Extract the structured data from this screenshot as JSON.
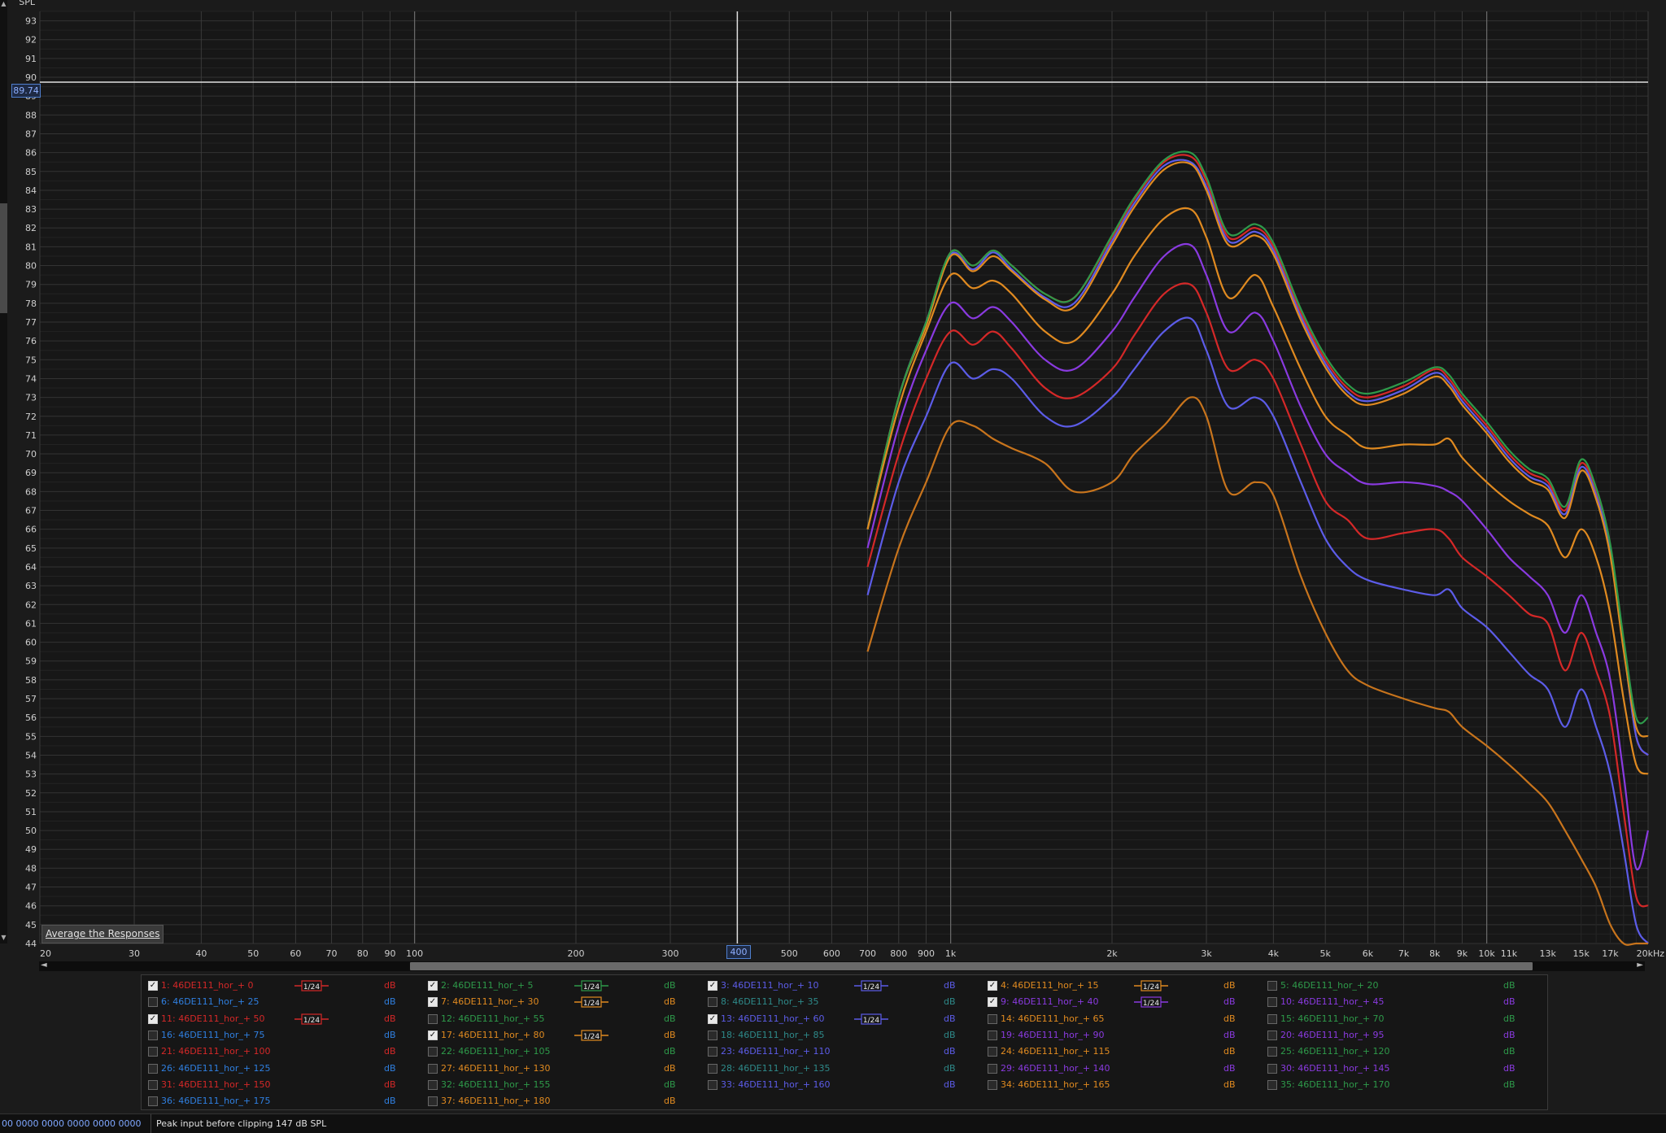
{
  "axis": {
    "y_label": "SPL",
    "x_unit_label": "20kHz"
  },
  "cursor": {
    "level_readout": "89.74",
    "freq_readout": "400",
    "level": 89.74,
    "freq": 400
  },
  "average_button": "Average the Responses",
  "status": {
    "left": "00 0000  0000 0000  0000 0000",
    "message": "Peak input before clipping 147 dB SPL"
  },
  "colors": {
    "background": "#1b1b1b",
    "grid_major": "#3a3a3a",
    "grid_minor": "#262626",
    "cursor": "#e0e0e0",
    "red": "#d42828",
    "blue": "#2f7fe0",
    "green": "#2e9a4a",
    "orange": "#e08a20",
    "purple": "#8a3ae0",
    "indigo": "#5c5ce8"
  },
  "chart_data": {
    "type": "line",
    "xscale": "log",
    "xlim": [
      20,
      20000
    ],
    "ylim": [
      44,
      93.5
    ],
    "ylabel": "SPL",
    "yticks": [
      44,
      45,
      46,
      47,
      48,
      49,
      50,
      51,
      52,
      53,
      54,
      55,
      56,
      57,
      58,
      59,
      60,
      61,
      62,
      63,
      64,
      65,
      66,
      67,
      68,
      69,
      70,
      71,
      72,
      73,
      74,
      75,
      76,
      77,
      78,
      79,
      80,
      81,
      82,
      83,
      84,
      85,
      86,
      87,
      88,
      89,
      90,
      91,
      92,
      93
    ],
    "xticks": [
      {
        "v": 20,
        "label": "20"
      },
      {
        "v": 30,
        "label": "30"
      },
      {
        "v": 40,
        "label": "40"
      },
      {
        "v": 50,
        "label": "50"
      },
      {
        "v": 60,
        "label": "60"
      },
      {
        "v": 70,
        "label": "70"
      },
      {
        "v": 80,
        "label": "80"
      },
      {
        "v": 90,
        "label": "90"
      },
      {
        "v": 100,
        "label": "100"
      },
      {
        "v": 200,
        "label": "200"
      },
      {
        "v": 300,
        "label": "300"
      },
      {
        "v": 400,
        "label": "400"
      },
      {
        "v": 500,
        "label": "500"
      },
      {
        "v": 600,
        "label": "600"
      },
      {
        "v": 700,
        "label": "700"
      },
      {
        "v": 800,
        "label": "800"
      },
      {
        "v": 900,
        "label": "900"
      },
      {
        "v": 1000,
        "label": "1k"
      },
      {
        "v": 2000,
        "label": "2k"
      },
      {
        "v": 3000,
        "label": "3k"
      },
      {
        "v": 4000,
        "label": "4k"
      },
      {
        "v": 5000,
        "label": "5k"
      },
      {
        "v": 6000,
        "label": "6k"
      },
      {
        "v": 7000,
        "label": "7k"
      },
      {
        "v": 8000,
        "label": "8k"
      },
      {
        "v": 9000,
        "label": "9k"
      },
      {
        "v": 10000,
        "label": "10k"
      },
      {
        "v": 11000,
        "label": "11k"
      },
      {
        "v": 13000,
        "label": "13k"
      },
      {
        "v": 15000,
        "label": "15k"
      },
      {
        "v": 17000,
        "label": "17k"
      },
      {
        "v": 20000,
        "label": "20kHz"
      }
    ],
    "x": [
      700,
      800,
      900,
      1000,
      1100,
      1200,
      1300,
      1500,
      1700,
      2000,
      2200,
      2500,
      2800,
      3000,
      3300,
      3700,
      4000,
      4500,
      5000,
      5500,
      6000,
      7000,
      8000,
      8500,
      9000,
      10000,
      11000,
      12000,
      13000,
      14000,
      15000,
      16000,
      17000,
      18000,
      19000,
      20000
    ],
    "series": [
      {
        "name": "1: 46DE111_hor_+ 0",
        "color": "#d42828",
        "values": [
          66,
          73,
          77,
          80.7,
          80,
          80.8,
          80,
          78.5,
          78.3,
          81.5,
          83.5,
          85.5,
          85.8,
          84.5,
          81.5,
          82,
          81,
          77.5,
          75,
          73.5,
          73,
          73.6,
          74.5,
          74,
          73,
          71.5,
          70,
          69,
          68.5,
          67,
          69.5,
          68,
          65,
          60,
          55,
          54
        ]
      },
      {
        "name": "3: 46DE111_hor_+ 10",
        "color": "#5c5ce8",
        "values": [
          66,
          73,
          77,
          80.6,
          79.8,
          80.7,
          79.8,
          78.3,
          78,
          81.3,
          83.3,
          85.3,
          85.5,
          84.2,
          81.3,
          81.8,
          80.8,
          77.3,
          74.8,
          73.3,
          72.8,
          73.4,
          74.3,
          73.8,
          72.8,
          71.3,
          69.8,
          68.8,
          68.3,
          66.8,
          69.3,
          67.8,
          64.8,
          59.8,
          55,
          54
        ]
      },
      {
        "name": "4: 46DE111_hor_+ 15",
        "color": "#e08a20",
        "values": [
          66,
          73,
          76.8,
          80.5,
          79.7,
          80.5,
          79.7,
          78.2,
          77.8,
          81.1,
          83.1,
          85.1,
          85.4,
          84,
          81.1,
          81.6,
          80.6,
          77.1,
          74.6,
          73.1,
          72.6,
          73.2,
          74.1,
          73.6,
          72.6,
          71.1,
          69.6,
          68.6,
          68.1,
          66.6,
          69.1,
          67.6,
          64.6,
          59.6,
          55.5,
          55
        ]
      },
      {
        "name": "2: 46DE111_hor_+ 5",
        "color": "#2e9a4a",
        "values": [
          66,
          73,
          77,
          80.7,
          80,
          80.8,
          80,
          78.5,
          78.3,
          81.6,
          83.6,
          85.6,
          86,
          84.7,
          81.7,
          82.2,
          81.2,
          77.7,
          75.2,
          73.7,
          73.2,
          73.8,
          74.6,
          74.2,
          73.2,
          71.7,
          70.2,
          69.2,
          68.7,
          67.2,
          69.7,
          68.2,
          65.2,
          60.2,
          56,
          56
        ]
      },
      {
        "name": "7: 46DE111_hor_+ 30",
        "color": "#e08a20",
        "values": [
          66,
          72.5,
          76.5,
          79.5,
          78.8,
          79.2,
          78.5,
          76.5,
          76,
          78.5,
          80.5,
          82.5,
          83,
          81.5,
          78.3,
          79.5,
          77.8,
          74.5,
          72,
          71,
          70.3,
          70.5,
          70.5,
          70.8,
          69.8,
          68.5,
          67.5,
          66.8,
          66.2,
          64.5,
          66,
          64.5,
          61.5,
          57,
          53.5,
          53
        ]
      },
      {
        "name": "9: 46DE111_hor_+ 40",
        "color": "#8a3ae0",
        "values": [
          65,
          71.5,
          75.5,
          78,
          77.2,
          77.8,
          77,
          75,
          74.5,
          76.5,
          78.3,
          80.5,
          81.1,
          79.5,
          76.5,
          77.5,
          76,
          72.5,
          70,
          69,
          68.4,
          68.5,
          68.3,
          68,
          67.5,
          66,
          64.5,
          63.5,
          62.5,
          60.5,
          62.5,
          60.5,
          58,
          53,
          48,
          50
        ]
      },
      {
        "name": "11: 46DE111_hor_+ 50",
        "color": "#d42828",
        "values": [
          64,
          70,
          74,
          76.5,
          75.8,
          76.5,
          75.6,
          73.5,
          73,
          74.5,
          76.3,
          78.5,
          79,
          77.5,
          74.5,
          75,
          74,
          70.5,
          67.5,
          66.5,
          65.5,
          65.8,
          66,
          65.5,
          64.5,
          63.5,
          62.5,
          61.5,
          61,
          58.5,
          60.5,
          58.5,
          56,
          51,
          46.5,
          46
        ]
      },
      {
        "name": "13: 46DE111_hor_+ 60",
        "color": "#5c5ce8",
        "values": [
          62.5,
          68.5,
          72,
          74.8,
          74,
          74.5,
          74,
          72,
          71.5,
          73,
          74.5,
          76.5,
          77.2,
          75.5,
          72.5,
          73,
          72,
          68.5,
          65.5,
          64,
          63.3,
          62.8,
          62.5,
          62.8,
          61.8,
          60.8,
          59.5,
          58.3,
          57.5,
          55.5,
          57.5,
          55.5,
          53,
          49,
          45,
          44
        ]
      },
      {
        "name": "17: 46DE111_hor_+ 80",
        "color": "#c8741c",
        "values": [
          59.5,
          65,
          68.5,
          71.5,
          71.5,
          70.8,
          70.3,
          69.5,
          68,
          68.5,
          70,
          71.5,
          73,
          72,
          68,
          68.5,
          67.8,
          63.5,
          60.5,
          58.5,
          57.7,
          57,
          56.5,
          56.3,
          55.5,
          54.5,
          53.5,
          52.5,
          51.5,
          50,
          48.5,
          47,
          45,
          44,
          44,
          44
        ]
      }
    ]
  },
  "legend": {
    "items": [
      {
        "label": "1: 46DE111_hor_+ 0",
        "color": "#d42828",
        "checked": true,
        "smooth": true,
        "db": "dB"
      },
      {
        "label": "2: 46DE111_hor_+ 5",
        "color": "#2e9a4a",
        "checked": true,
        "smooth": true,
        "db": "dB"
      },
      {
        "label": "3: 46DE111_hor_+ 10",
        "color": "#5c5ce8",
        "checked": true,
        "smooth": true,
        "db": "dB"
      },
      {
        "label": "4: 46DE111_hor_+ 15",
        "color": "#e08a20",
        "checked": true,
        "smooth": true,
        "db": "dB"
      },
      {
        "label": "5: 46DE111_hor_+ 20",
        "color": "#2e9a4a",
        "checked": false,
        "smooth": false,
        "db": "dB"
      },
      {
        "label": "6: 46DE111_hor_+ 25",
        "color": "#2f7fe0",
        "checked": false,
        "smooth": false,
        "db": "dB"
      },
      {
        "label": "7: 46DE111_hor_+ 30",
        "color": "#e08a20",
        "checked": true,
        "smooth": true,
        "db": "dB"
      },
      {
        "label": "8: 46DE111_hor_+ 35",
        "color": "#2e8a8a",
        "checked": false,
        "smooth": false,
        "db": "dB"
      },
      {
        "label": "9: 46DE111_hor_+ 40",
        "color": "#8a3ae0",
        "checked": true,
        "smooth": true,
        "db": "dB"
      },
      {
        "label": "10: 46DE111_hor_+ 45",
        "color": "#8a3ae0",
        "checked": false,
        "smooth": false,
        "db": "dB"
      },
      {
        "label": "11: 46DE111_hor_+ 50",
        "color": "#d42828",
        "checked": true,
        "smooth": true,
        "db": "dB"
      },
      {
        "label": "12: 46DE111_hor_+ 55",
        "color": "#2e9a4a",
        "checked": false,
        "smooth": false,
        "db": "dB"
      },
      {
        "label": "13: 46DE111_hor_+ 60",
        "color": "#5c5ce8",
        "checked": true,
        "smooth": true,
        "db": "dB"
      },
      {
        "label": "14: 46DE111_hor_+ 65",
        "color": "#e08a20",
        "checked": false,
        "smooth": false,
        "db": "dB"
      },
      {
        "label": "15: 46DE111_hor_+ 70",
        "color": "#2e9a4a",
        "checked": false,
        "smooth": false,
        "db": "dB"
      },
      {
        "label": "16: 46DE111_hor_+ 75",
        "color": "#2f7fe0",
        "checked": false,
        "smooth": false,
        "db": "dB"
      },
      {
        "label": "17: 46DE111_hor_+ 80",
        "color": "#e08a20",
        "checked": true,
        "smooth": true,
        "db": "dB"
      },
      {
        "label": "18: 46DE111_hor_+ 85",
        "color": "#2e8a8a",
        "checked": false,
        "smooth": false,
        "db": "dB"
      },
      {
        "label": "19: 46DE111_hor_+ 90",
        "color": "#8a3ae0",
        "checked": false,
        "smooth": false,
        "db": "dB"
      },
      {
        "label": "20: 46DE111_hor_+ 95",
        "color": "#8a3ae0",
        "checked": false,
        "smooth": false,
        "db": "dB"
      },
      {
        "label": "21: 46DE111_hor_+ 100",
        "color": "#d42828",
        "checked": false,
        "smooth": false,
        "db": "dB"
      },
      {
        "label": "22: 46DE111_hor_+ 105",
        "color": "#2e9a4a",
        "checked": false,
        "smooth": false,
        "db": "dB"
      },
      {
        "label": "23: 46DE111_hor_+ 110",
        "color": "#5c5ce8",
        "checked": false,
        "smooth": false,
        "db": "dB"
      },
      {
        "label": "24: 46DE111_hor_+ 115",
        "color": "#e08a20",
        "checked": false,
        "smooth": false,
        "db": "dB"
      },
      {
        "label": "25: 46DE111_hor_+ 120",
        "color": "#2e9a4a",
        "checked": false,
        "smooth": false,
        "db": "dB"
      },
      {
        "label": "26: 46DE111_hor_+ 125",
        "color": "#2f7fe0",
        "checked": false,
        "smooth": false,
        "db": "dB"
      },
      {
        "label": "27: 46DE111_hor_+ 130",
        "color": "#e08a20",
        "checked": false,
        "smooth": false,
        "db": "dB"
      },
      {
        "label": "28: 46DE111_hor_+ 135",
        "color": "#2e8a8a",
        "checked": false,
        "smooth": false,
        "db": "dB"
      },
      {
        "label": "29: 46DE111_hor_+ 140",
        "color": "#8a3ae0",
        "checked": false,
        "smooth": false,
        "db": "dB"
      },
      {
        "label": "30: 46DE111_hor_+ 145",
        "color": "#8a3ae0",
        "checked": false,
        "smooth": false,
        "db": "dB"
      },
      {
        "label": "31: 46DE111_hor_+ 150",
        "color": "#d42828",
        "checked": false,
        "smooth": false,
        "db": "dB"
      },
      {
        "label": "32: 46DE111_hor_+ 155",
        "color": "#2e9a4a",
        "checked": false,
        "smooth": false,
        "db": "dB"
      },
      {
        "label": "33: 46DE111_hor_+ 160",
        "color": "#5c5ce8",
        "checked": false,
        "smooth": false,
        "db": "dB"
      },
      {
        "label": "34: 46DE111_hor_+ 165",
        "color": "#e08a20",
        "checked": false,
        "smooth": false,
        "db": "dB"
      },
      {
        "label": "35: 46DE111_hor_+ 170",
        "color": "#2e9a4a",
        "checked": false,
        "smooth": false,
        "db": "dB"
      },
      {
        "label": "36: 46DE111_hor_+ 175",
        "color": "#2f7fe0",
        "checked": false,
        "smooth": false,
        "db": "dB"
      },
      {
        "label": "37: 46DE111_hor_+ 180",
        "color": "#e08a20",
        "checked": false,
        "smooth": false,
        "db": "dB"
      }
    ]
  }
}
